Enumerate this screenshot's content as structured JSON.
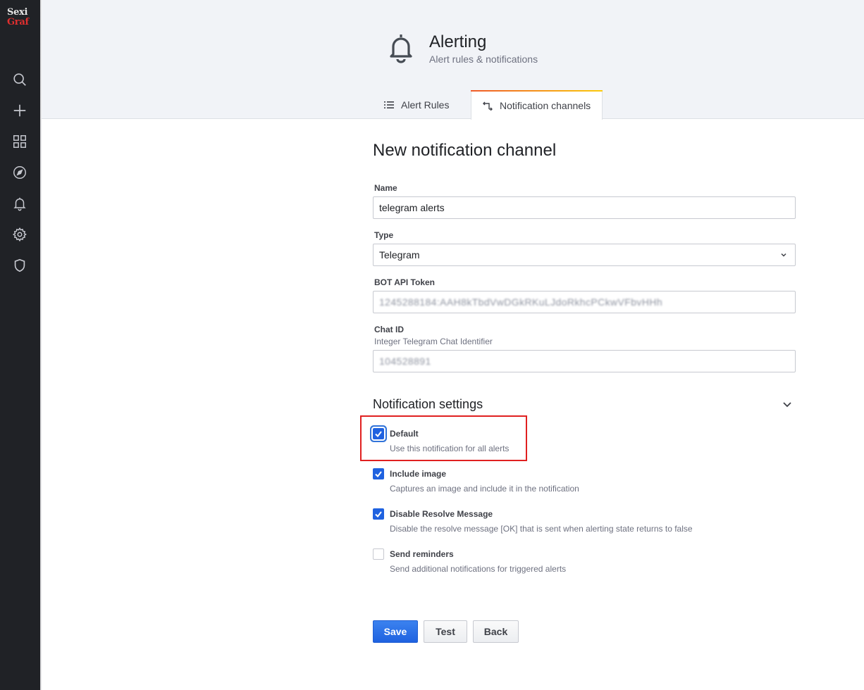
{
  "sidebar": {
    "logo_line1": "Sexi",
    "logo_line2": "Graf",
    "icons": [
      "search-icon",
      "plus-icon",
      "dashboards-icon",
      "explore-icon",
      "bell-icon",
      "gear-icon",
      "shield-icon"
    ]
  },
  "header": {
    "title": "Alerting",
    "subtitle": "Alert rules & notifications",
    "tabs": [
      {
        "label": "Alert Rules",
        "active": false
      },
      {
        "label": "Notification channels",
        "active": true
      }
    ]
  },
  "form": {
    "title": "New notification channel",
    "name": {
      "label": "Name",
      "value": "telegram alerts"
    },
    "type": {
      "label": "Type",
      "value": "Telegram"
    },
    "bot_token": {
      "label": "BOT API Token",
      "value": "1245288184:AAH8kTbdVwDGkRKuLJdoRkhcPCkwVFbvHHh"
    },
    "chat_id": {
      "label": "Chat ID",
      "description": "Integer Telegram Chat Identifier",
      "value": "104528891"
    }
  },
  "notification_settings": {
    "title": "Notification settings",
    "options": [
      {
        "label": "Default",
        "description": "Use this notification for all alerts",
        "checked": true
      },
      {
        "label": "Include image",
        "description": "Captures an image and include it in the notification",
        "checked": true
      },
      {
        "label": "Disable Resolve Message",
        "description": "Disable the resolve message [OK] that is sent when alerting state returns to false",
        "checked": true
      },
      {
        "label": "Send reminders",
        "description": "Send additional notifications for triggered alerts",
        "checked": false
      }
    ]
  },
  "buttons": {
    "save": "Save",
    "test": "Test",
    "back": "Back"
  },
  "colors": {
    "sidebar_bg": "#202226",
    "primary": "#1f62e0",
    "highlight": "#e02020"
  }
}
